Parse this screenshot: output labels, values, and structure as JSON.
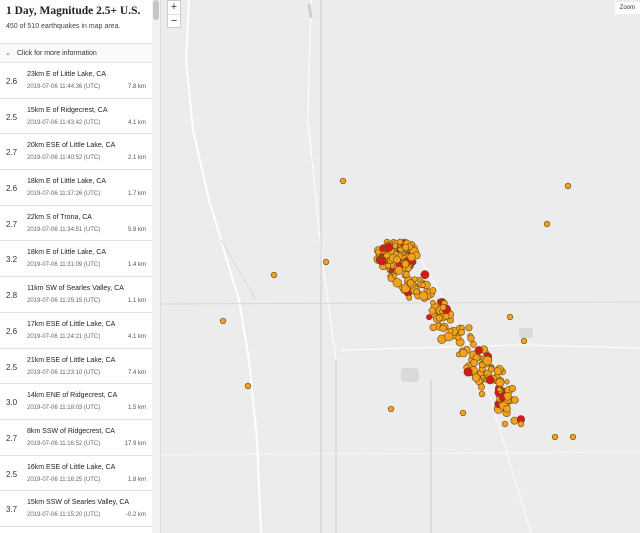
{
  "sidebar": {
    "title": "1 Day, Magnitude 2.5+ U.S.",
    "subtitle": "450 of 510 earthquakes in map area.",
    "info_toggle": "Click for more information",
    "earthquakes": [
      {
        "mag": "2.6",
        "place": "23km E of Little Lake, CA",
        "time": "2019-07-06 11:44:36 (UTC)",
        "depth": "7.8 km"
      },
      {
        "mag": "2.5",
        "place": "15km E of Ridgecrest, CA",
        "time": "2019-07-06 11:43:42 (UTC)",
        "depth": "4.1 km"
      },
      {
        "mag": "2.7",
        "place": "20km ESE of Little Lake, CA",
        "time": "2019-07-06 11:40:52 (UTC)",
        "depth": "2.1 km"
      },
      {
        "mag": "2.6",
        "place": "18km E of Little Lake, CA",
        "time": "2019-07-06 11:37:26 (UTC)",
        "depth": "1.7 km"
      },
      {
        "mag": "2.7",
        "place": "22km S of Trona, CA",
        "time": "2019-07-06 11:34:51 (UTC)",
        "depth": "5.8 km"
      },
      {
        "mag": "3.2",
        "place": "18km E of Little Lake, CA",
        "time": "2019-07-06 11:31:09 (UTC)",
        "depth": "1.4 km"
      },
      {
        "mag": "2.8",
        "place": "11km SW of Searles Valley, CA",
        "time": "2019-07-06 11:25:15 (UTC)",
        "depth": "1.1 km"
      },
      {
        "mag": "2.6",
        "place": "17km ESE of Little Lake, CA",
        "time": "2019-07-06 11:24:21 (UTC)",
        "depth": "4.1 km"
      },
      {
        "mag": "2.5",
        "place": "21km ESE of Little Lake, CA",
        "time": "2019-07-06 11:23:10 (UTC)",
        "depth": "7.4 km"
      },
      {
        "mag": "3.0",
        "place": "14km ENE of Ridgecrest, CA",
        "time": "2019-07-06 11:18:03 (UTC)",
        "depth": "1.5 km"
      },
      {
        "mag": "2.7",
        "place": "8km SSW of Ridgecrest, CA",
        "time": "2019-07-06 11:16:52 (UTC)",
        "depth": "17.9 km"
      },
      {
        "mag": "2.5",
        "place": "16km ESE of Little Lake, CA",
        "time": "2019-07-06 11:16:25 (UTC)",
        "depth": "1.8 km"
      },
      {
        "mag": "3.7",
        "place": "15km SSW of Searles Valley, CA",
        "time": "2019-07-06 11:15:20 (UTC)",
        "depth": "-0.2 km"
      }
    ]
  },
  "map": {
    "zoom_in": "+",
    "zoom_out": "−",
    "zoom_label": "Zoom",
    "colors": {
      "background": "#ececec",
      "quake_orange": "#f2a21f",
      "quake_red": "#d7191c",
      "outline": "#6b4a10",
      "road": "#ffffff",
      "border": "#bdbdbd"
    }
  }
}
